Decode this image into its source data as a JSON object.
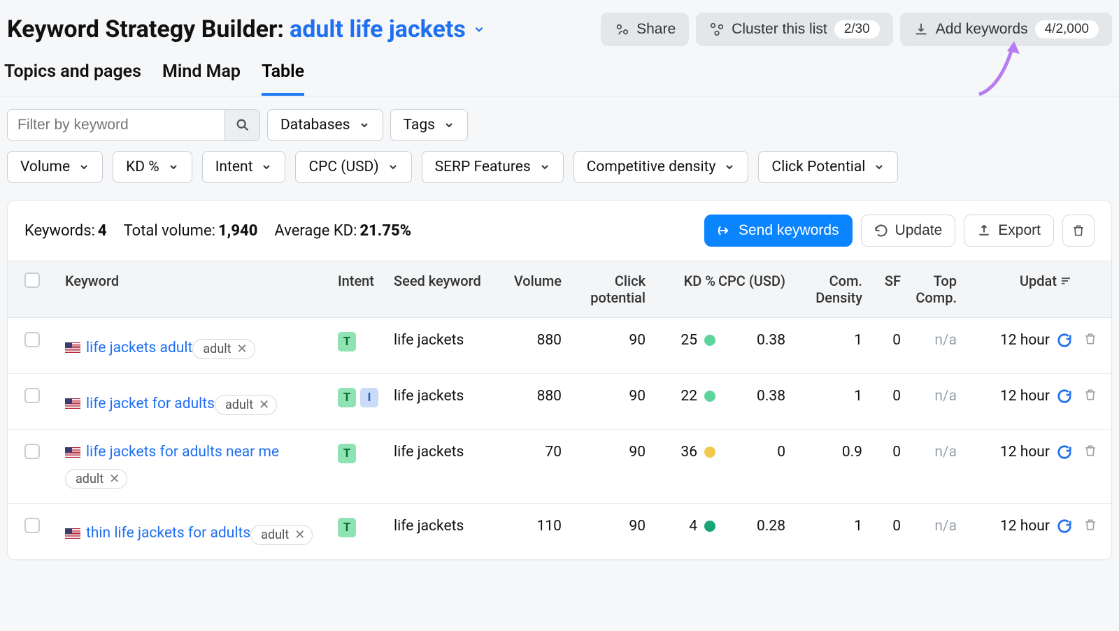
{
  "header": {
    "title_prefix": "Keyword Strategy Builder:",
    "title_keyword": "adult life jackets",
    "actions": {
      "share": "Share",
      "cluster": "Cluster this list",
      "cluster_count": "2/30",
      "add": "Add keywords",
      "add_count": "4/2,000"
    }
  },
  "tabs": [
    "Topics and pages",
    "Mind Map",
    "Table"
  ],
  "active_tab": "Table",
  "filters": {
    "search_placeholder": "Filter by keyword",
    "databases": "Databases",
    "tags": "Tags",
    "row2": [
      "Volume",
      "KD %",
      "Intent",
      "CPC (USD)",
      "SERP Features",
      "Competitive density",
      "Click Potential"
    ]
  },
  "summary": {
    "keywords_label": "Keywords:",
    "keywords_value": "4",
    "volume_label": "Total volume:",
    "volume_value": "1,940",
    "kd_label": "Average KD:",
    "kd_value": "21.75%"
  },
  "table_actions": {
    "send": "Send keywords",
    "update": "Update",
    "export": "Export"
  },
  "columns": {
    "keyword": "Keyword",
    "intent": "Intent",
    "seed": "Seed keyword",
    "volume": "Volume",
    "click": "Click potential",
    "kd": "KD %",
    "cpc": "CPC (USD)",
    "density": "Com. Density",
    "sf": "SF",
    "top": "Top Comp.",
    "updated": "Updat"
  },
  "rows": [
    {
      "keyword": "life jackets adult",
      "tag": "adult",
      "intents": [
        "T"
      ],
      "seed": "life jackets",
      "volume": "880",
      "click": "90",
      "kd": "25",
      "kd_color": "#5dd39e",
      "cpc": "0.38",
      "density": "1",
      "sf": "0",
      "top": "n/a",
      "updated": "12 hour"
    },
    {
      "keyword": "life jacket for adults",
      "tag": "adult",
      "intents": [
        "T",
        "I"
      ],
      "seed": "life jackets",
      "volume": "880",
      "click": "90",
      "kd": "22",
      "kd_color": "#5dd39e",
      "cpc": "0.38",
      "density": "1",
      "sf": "0",
      "top": "n/a",
      "updated": "12 hour"
    },
    {
      "keyword": "life jackets for adults near me",
      "tag": "adult",
      "intents": [
        "T"
      ],
      "seed": "life jackets",
      "volume": "70",
      "click": "90",
      "kd": "36",
      "kd_color": "#f2c94c",
      "cpc": "0",
      "density": "0.9",
      "sf": "0",
      "top": "n/a",
      "updated": "12 hour"
    },
    {
      "keyword": "thin life jackets for adults",
      "tag": "adult",
      "intents": [
        "T"
      ],
      "seed": "life jackets",
      "volume": "110",
      "click": "90",
      "kd": "4",
      "kd_color": "#17a673",
      "cpc": "0.28",
      "density": "1",
      "sf": "0",
      "top": "n/a",
      "updated": "12 hour"
    }
  ]
}
